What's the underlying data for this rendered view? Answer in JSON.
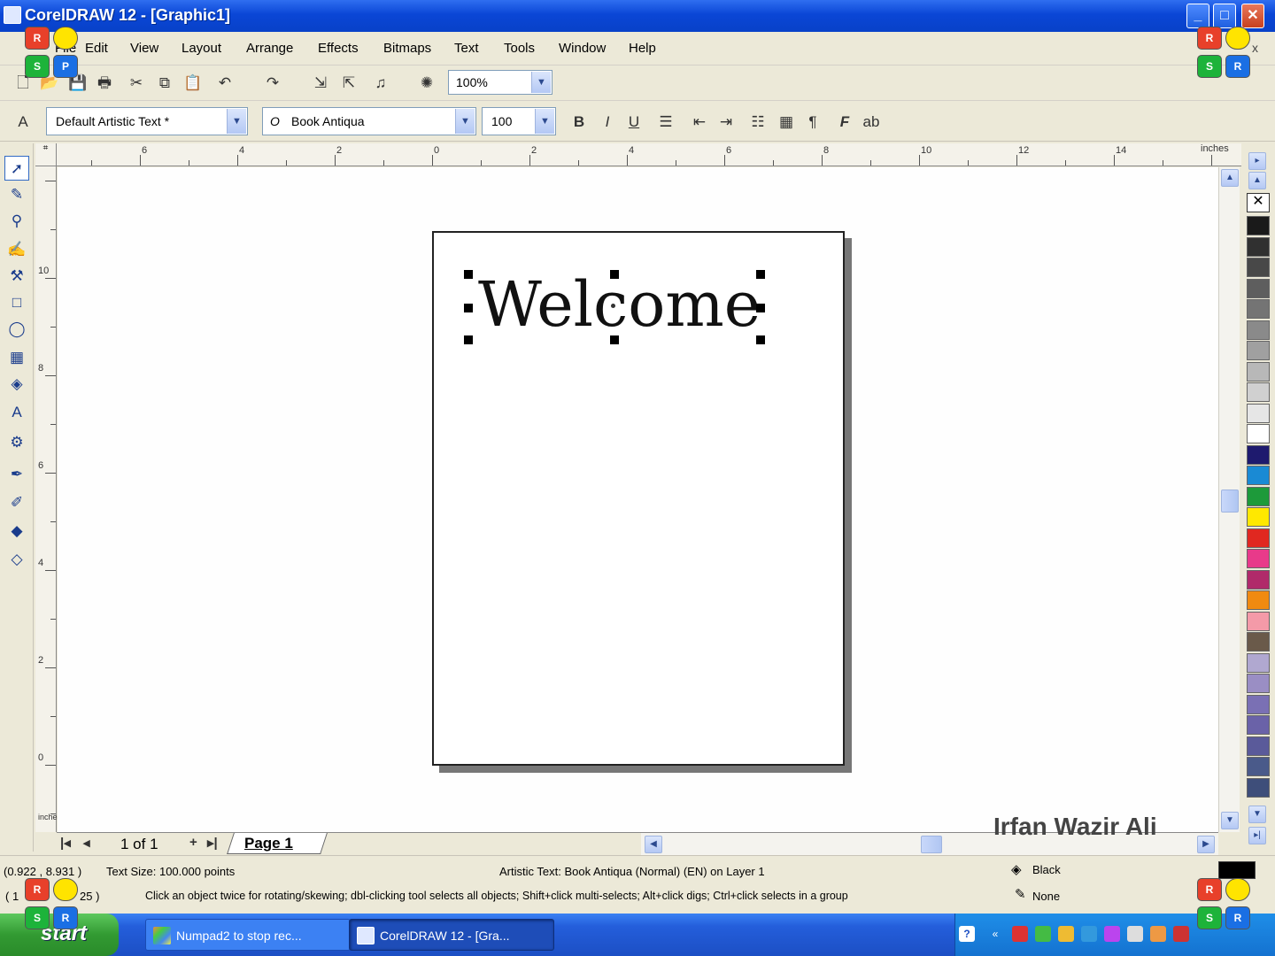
{
  "window": {
    "title": "CorelDRAW 12 - [Graphic1]",
    "min": "_",
    "max": "□",
    "close": "✕"
  },
  "menu": {
    "items": [
      "File",
      "Edit",
      "View",
      "Layout",
      "Arrange",
      "Effects",
      "Bitmaps",
      "Text",
      "Tools",
      "Window",
      "Help"
    ],
    "mdi_close": "x"
  },
  "overlay": {
    "r": "R",
    "s": "S",
    "p": "P",
    "ss": "S",
    "rr": "R"
  },
  "toolbar": {
    "zoom": "100%"
  },
  "propbar": {
    "text_style": "Default Artistic Text *",
    "font_name": "Book Antiqua",
    "font_size": "100"
  },
  "ruler": {
    "h_numbers": [
      "6",
      "4",
      "2",
      "0",
      "2",
      "4",
      "6",
      "8",
      "10",
      "12",
      "14"
    ],
    "h_units": "inches",
    "v_numbers": [
      "10",
      "8",
      "6",
      "4",
      "2",
      "0"
    ],
    "v_units": "inches"
  },
  "canvas": {
    "text": "Welcome"
  },
  "pagenav": {
    "first": "|◂",
    "prev": "◂",
    "count": "1 of 1",
    "add": "+",
    "last": "▸|",
    "page_tab": "Page 1"
  },
  "watermark": "Irfan Wazir Ali",
  "status": {
    "coords": "(0.922 , 8.931 )",
    "text_size": "Text Size: 100.000 points",
    "object_info": "Artistic Text: Book Antiqua (Normal) (EN) on Layer 1",
    "fill_label": "Black",
    "outline_label": "None",
    "coords2": "( 1",
    "coords2b": "25 )",
    "hint": "Click an object twice for rotating/skewing; dbl-clicking tool selects all objects; Shift+click multi-selects; Alt+click digs; Ctrl+click selects in a group"
  },
  "taskbar": {
    "start": "start",
    "tasks": [
      "Numpad2 to stop rec...",
      "CorelDRAW 12 - [Gra..."
    ]
  },
  "palette": {
    "colors": [
      "#1a1a1a",
      "#303030",
      "#484848",
      "#5e5e5e",
      "#747474",
      "#8a8a8a",
      "#a0a0a0",
      "#b8b8b8",
      "#d0d0d0",
      "#e6e6e6",
      "#ffffff",
      "#1e1a6e",
      "#1a8ad4",
      "#1d9a3a",
      "#ffe800",
      "#e02820",
      "#e83a8a",
      "#b02a6a",
      "#f08a10",
      "#f49aa8",
      "#6a5a4a",
      "#b0a8d0",
      "#9a8ec4",
      "#7a70b4",
      "#6a62a8",
      "#5a5a9a",
      "#4a5a8a",
      "#3e4e7a"
    ]
  }
}
